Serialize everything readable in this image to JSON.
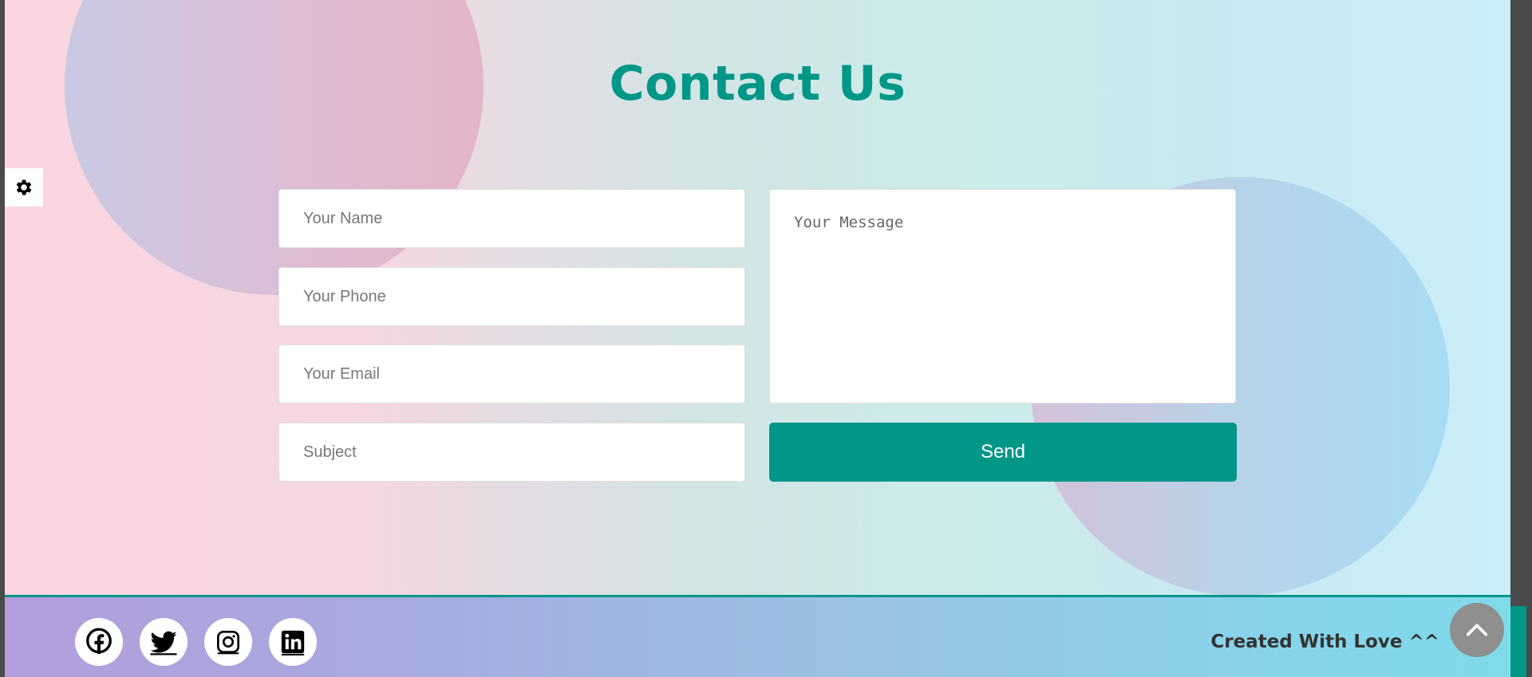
{
  "contact": {
    "title": "Contact Us",
    "fields": {
      "name_placeholder": "Your Name",
      "phone_placeholder": "Your Phone",
      "email_placeholder": "Your Email",
      "subject_placeholder": "Subject",
      "message_placeholder": "Your Message"
    },
    "send_label": "Send"
  },
  "settings": {
    "icon": "gear-icon"
  },
  "footer": {
    "social": [
      {
        "name": "facebook",
        "icon": "facebook-icon"
      },
      {
        "name": "twitter",
        "icon": "twitter-icon"
      },
      {
        "name": "instagram",
        "icon": "instagram-icon"
      },
      {
        "name": "linkedin",
        "icon": "linkedin-icon"
      }
    ],
    "credit": "Created With Love ^^"
  },
  "scroll_top": {
    "icon": "chevron-up-icon"
  },
  "colors": {
    "accent": "#009688",
    "title": "#009688",
    "scroll_button": "#8f8f8f"
  }
}
